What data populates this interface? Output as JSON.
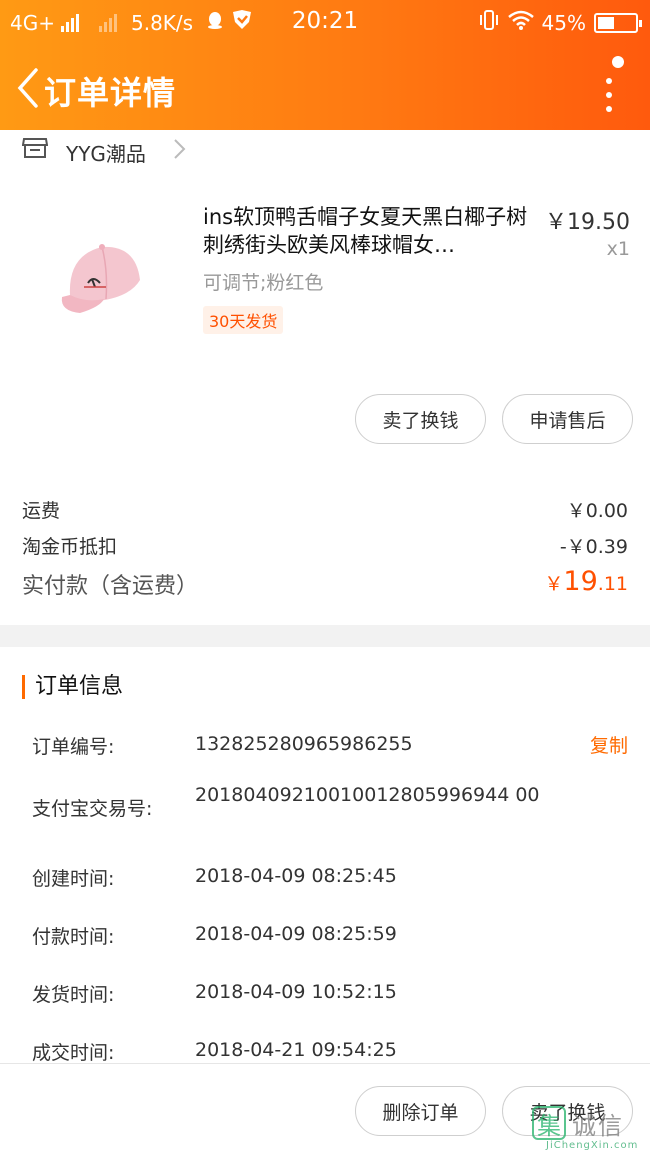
{
  "status_bar": {
    "network": "4G+",
    "speed": "5.8K/s",
    "time": "20:21",
    "battery": "45%",
    "battery_level": 0.45,
    "icons": [
      "signal-icon",
      "qq-icon",
      "shield-icon",
      "vibrate-icon",
      "wifi-icon",
      "battery-icon"
    ]
  },
  "header": {
    "title": "订单详情",
    "back_icon": "chevron-left-icon",
    "more_icon": "more-vertical-icon"
  },
  "shop": {
    "name": "YYG潮品",
    "icon": "shop-icon"
  },
  "product": {
    "title": "ins软顶鸭舌帽子女夏天黑白椰子树刺绣街头欧美风棒球帽女…",
    "spec": "可调节;粉红色",
    "tag": "30天发货",
    "price": "￥19.50",
    "quantity": "x1"
  },
  "item_actions": {
    "sell_for_cash": "卖了换钱",
    "after_sales": "申请售后"
  },
  "fees": {
    "shipping_label": "运费",
    "shipping_value": "￥0.00",
    "coin_label": "淘金币抵扣",
    "coin_value": "-￥0.39",
    "paid_label": "实付款（含运费）",
    "paid_currency": "￥",
    "paid_int": "19",
    "paid_dec": ".11"
  },
  "order_info": {
    "section_title": "订单信息",
    "copy_label": "复制",
    "rows": [
      {
        "label": "订单编号:",
        "value": "132825280965986255"
      },
      {
        "label": "支付宝交易号:",
        "value": "20180409210010012805996944 00"
      },
      {
        "label": "创建时间:",
        "value": "2018-04-09 08:25:45"
      },
      {
        "label": "付款时间:",
        "value": "2018-04-09 08:25:59"
      },
      {
        "label": "发货时间:",
        "value": "2018-04-09 10:52:15"
      },
      {
        "label": "成交时间:",
        "value": "2018-04-21 09:54:25"
      }
    ]
  },
  "bottom_actions": {
    "delete_order": "删除订单",
    "sell_for_cash": "卖了换钱"
  },
  "watermark": {
    "text": "诚信",
    "sub": "JiChengXin.com",
    "box": "集"
  },
  "colors": {
    "accent": "#ff6a00",
    "price_red": "#ff5000",
    "header_from": "#ff9a14",
    "header_to": "#ff5a0d"
  }
}
